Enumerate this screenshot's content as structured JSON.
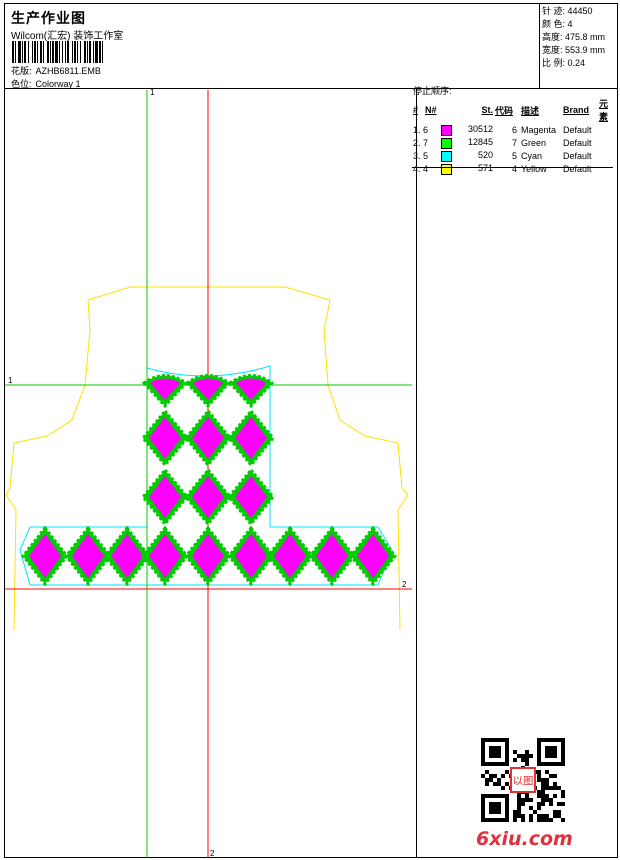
{
  "header": {
    "title": "生产作业图",
    "company": "Wilcom(汇宏)  装饰工作室",
    "design_label": "花版:",
    "design_value": "AZHB6811.EMB",
    "colorway_label": "色位:",
    "colorway_value": "Colorway 1"
  },
  "stats": [
    {
      "label": "针 迹:",
      "value": "44450"
    },
    {
      "label": "颜 色:",
      "value": "4"
    },
    {
      "label": "高度:",
      "value": "475.8 mm"
    },
    {
      "label": "宽度:",
      "value": "553.9 mm"
    },
    {
      "label": "比 例:",
      "value": "0.24"
    }
  ],
  "stop_sequence": {
    "heading": "停止顺序:",
    "columns": [
      "#",
      "N#",
      "St.",
      "代码",
      "描述",
      "Brand",
      "元素"
    ],
    "rows": [
      {
        "idx": "1. 6",
        "color": "#ff00ff",
        "st": "30512",
        "code": "6",
        "desc": "Magenta",
        "brand": "Default"
      },
      {
        "idx": "2. 7",
        "color": "#00ff00",
        "st": "12845",
        "code": "7",
        "desc": "Green",
        "brand": "Default"
      },
      {
        "idx": "3. 5",
        "color": "#00ffff",
        "st": "520",
        "code": "5",
        "desc": "Cyan",
        "brand": "Default"
      },
      {
        "idx": "4. 4",
        "color": "#ffff00",
        "st": "571",
        "code": "4",
        "desc": "Yellow",
        "brand": "Default"
      }
    ]
  },
  "axis_labels": {
    "v_green": "1",
    "h_green": "1",
    "h_red": "2",
    "v_red": "2"
  },
  "colors": {
    "magenta": "#ff00ff",
    "green": "#00cc00",
    "cyan": "#00e5ff",
    "yellow": "#ffe000",
    "red": "#ff0000",
    "axis_green": "#00c800"
  },
  "watermark": "6xiu.com",
  "seal_text": "以图"
}
